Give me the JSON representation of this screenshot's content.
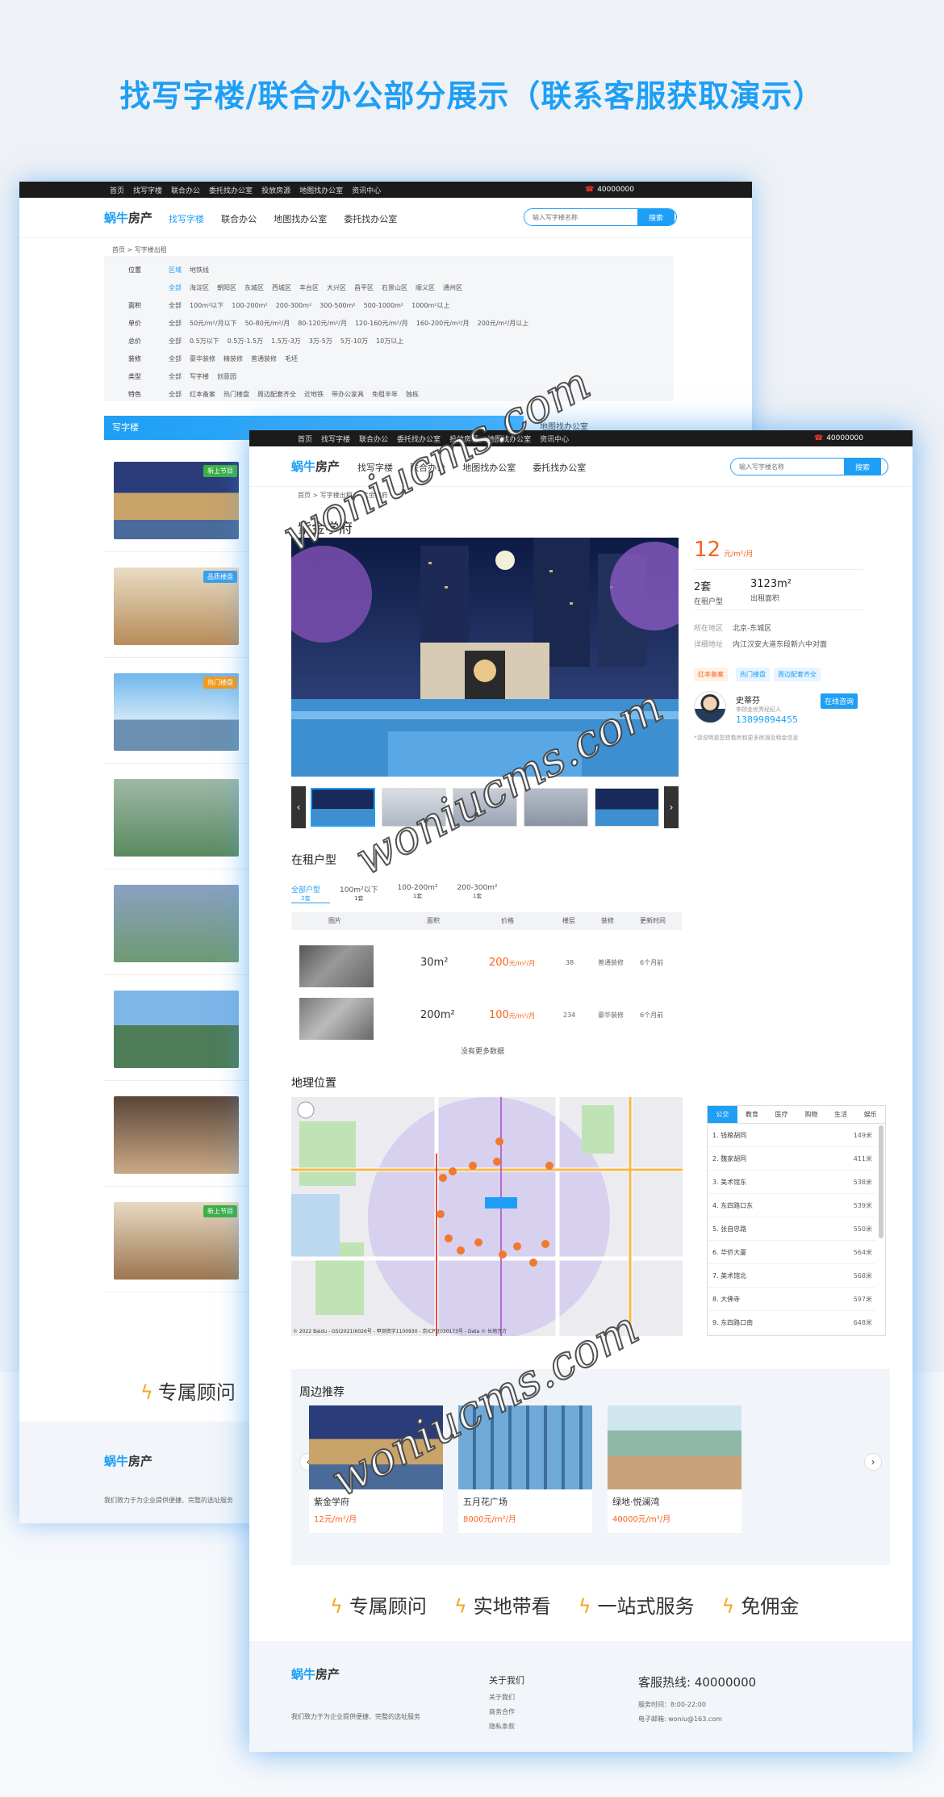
{
  "heading": "找写字楼/联合办公部分展示（联系客服获取演示）",
  "watermark": "woniucms.com",
  "topbar": {
    "items": [
      "首页",
      "找写字楼",
      "联合办公",
      "委托找办公室",
      "投放房源",
      "地图找办公室",
      "资讯中心"
    ],
    "phone": "40000000"
  },
  "logo": {
    "brand": "蜗牛",
    "suffix": "房产"
  },
  "nav": {
    "items": [
      "找写字楼",
      "联合办公",
      "地图找办公室",
      "委托找办公室"
    ]
  },
  "search": {
    "placeholder": "输入写字楼名称",
    "button": "搜索"
  },
  "list_page": {
    "breadcrumb": "首页 > 写字楼出租",
    "filter": {
      "position_label": "位置",
      "position_tabs": [
        "区域",
        "地铁线"
      ],
      "districts": [
        "全部",
        "海淀区",
        "朝阳区",
        "东城区",
        "西城区",
        "丰台区",
        "大兴区",
        "昌平区",
        "石景山区",
        "顺义区",
        "通州区"
      ],
      "rows": [
        {
          "label": "面积",
          "options": [
            "全部",
            "100m²以下",
            "100-200m²",
            "200-300m²",
            "300-500m²",
            "500-1000m²",
            "1000m²以上"
          ]
        },
        {
          "label": "单价",
          "options": [
            "全部",
            "50元/m²/月以下",
            "50-80元/m²/月",
            "80-120元/m²/月",
            "120-160元/m²/月",
            "160-200元/m²/月",
            "200元/m²/月以上"
          ]
        },
        {
          "label": "总价",
          "options": [
            "全部",
            "0.5万以下",
            "0.5万-1.5万",
            "1.5万-3万",
            "3万-5万",
            "5万-10万",
            "10万以上"
          ]
        },
        {
          "label": "装修",
          "options": [
            "全部",
            "豪华装修",
            "精装修",
            "普通装修",
            "毛坯"
          ]
        },
        {
          "label": "类型",
          "options": [
            "全部",
            "写字楼",
            "创意园"
          ]
        },
        {
          "label": "特色",
          "options": [
            "全部",
            "红本备案",
            "热门楼盘",
            "周边配套齐全",
            "近地铁",
            "带办公家具",
            "免租半年",
            "独栋"
          ]
        }
      ]
    },
    "list_title": "写字楼",
    "map_link": "地图找办公室",
    "badges": [
      "新上节目",
      "品质楼盘",
      "热门楼盘",
      "新上节目"
    ],
    "advisor": "专属顾问",
    "footer_text": "我们致力于为企业提供便捷、完整的选址服务"
  },
  "detail_page": {
    "breadcrumb": "首页 > 写字楼出租 > 紫金学府",
    "title": "紫金学府",
    "price": "12",
    "price_unit": "元/m²/月",
    "stats": [
      {
        "value": "2套",
        "label": "在租户型"
      },
      {
        "value": "3123m²",
        "label": "出租面积"
      }
    ],
    "location_label": "所在地区",
    "location": "北京-东城区",
    "address_label": "详细地址",
    "address": "内江汉安大道东段新六中对面",
    "tags": [
      "红本备案",
      "热门楼盘",
      "周边配套齐全"
    ],
    "agent": {
      "name": "史蒂芬",
      "title": "李顾金优秀经纪人",
      "phone": "13899894455",
      "consult": "在线咨询"
    },
    "agent_note": "*请说明是您想看房和更多房源及租金信息",
    "rental_section": "在租户型",
    "rental_tabs": [
      {
        "label": "全部户型",
        "count": "2套"
      },
      {
        "label": "100m²以下",
        "count": "1套"
      },
      {
        "label": "100-200m²",
        "count": "1套"
      },
      {
        "label": "200-300m²",
        "count": "1套"
      }
    ],
    "table_headers": [
      "图片",
      "面积",
      "价格",
      "楼层",
      "装修",
      "更新时间"
    ],
    "rows": [
      {
        "area": "30m²",
        "price": "200",
        "unit": "元/m²/月",
        "floor": "38",
        "decor": "普通装修",
        "updated": "6个月前"
      },
      {
        "area": "200m²",
        "price": "100",
        "unit": "元/m²/月",
        "floor": "234",
        "decor": "豪华装修",
        "updated": "6个月前"
      }
    ],
    "no_more": "没有更多数据",
    "map_section": "地理位置",
    "map_copyright": "© 2022 Baidu - GS(2021)6026号 - 甲测资字1100930 - 京ICP证030173号 - Data © 长地万方",
    "poi_tabs": [
      "公交",
      "教育",
      "医疗",
      "购物",
      "生活",
      "娱乐"
    ],
    "poi": [
      {
        "name": "1. 钱粮胡同",
        "dist": "149米"
      },
      {
        "name": "2. 魏家胡同",
        "dist": "411米"
      },
      {
        "name": "3. 美术馆东",
        "dist": "538米"
      },
      {
        "name": "4. 东四路口东",
        "dist": "539米"
      },
      {
        "name": "5. 张自忠路",
        "dist": "550米"
      },
      {
        "name": "6. 华侨大厦",
        "dist": "564米"
      },
      {
        "name": "7. 美术馆北",
        "dist": "568米"
      },
      {
        "name": "8. 大佛寺",
        "dist": "597米"
      },
      {
        "name": "9. 东四路口南",
        "dist": "648米"
      }
    ],
    "nearby_section": "周边推荐",
    "nearby": [
      {
        "name": "紫金学府",
        "price": "12元/m²/月"
      },
      {
        "name": "五月花广场",
        "price": "8000元/m²/月"
      },
      {
        "name": "绿地·悦澜湾",
        "price": "40000元/m²/月"
      }
    ],
    "services": [
      "专属顾问",
      "实地带看",
      "一站式服务",
      "免佣金"
    ],
    "footer": {
      "text": "我们致力于为企业提供便捷、完整的选址服务",
      "about_title": "关于我们",
      "about_links": [
        "关于我们",
        "商务合作",
        "隐私条款"
      ],
      "hotline": "客服热线: 40000000",
      "hours": "服务时间：8:00-22:00",
      "email": "电子邮箱: woniu@163.com"
    }
  }
}
